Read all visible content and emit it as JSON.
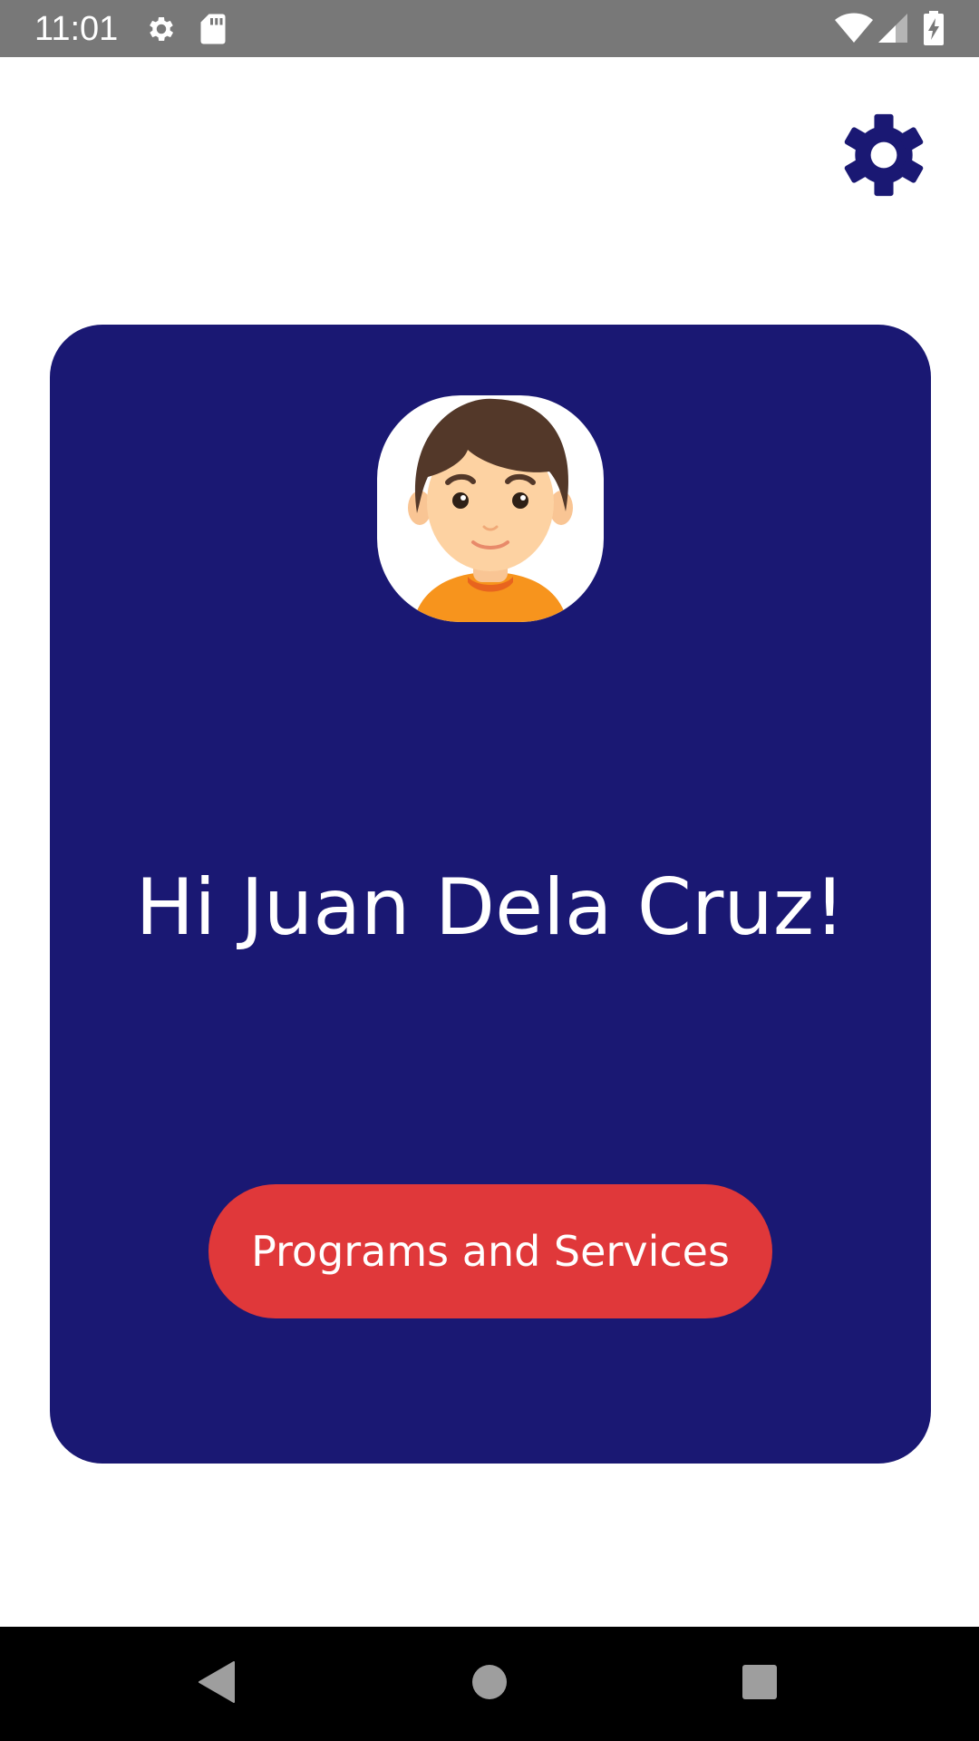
{
  "status_bar": {
    "time": "11:01",
    "icons": [
      "settings-icon",
      "sd-card-icon",
      "wifi-icon",
      "signal-icon",
      "battery-charging-icon"
    ]
  },
  "header": {
    "settings_icon": "gear-icon"
  },
  "card": {
    "avatar_icon": "boy-avatar",
    "greeting": "Hi Juan Dela Cruz!",
    "button_label": "Programs and Services"
  },
  "nav_bar": {
    "icons": [
      "back-icon",
      "home-icon",
      "recents-icon"
    ]
  },
  "colors": {
    "status_bar": "#787878",
    "card_background": "#1a1873",
    "accent_button": "#e0383a",
    "gear": "#1a1873",
    "nav_bar": "#000000",
    "nav_icons": "#9e9e9e"
  }
}
